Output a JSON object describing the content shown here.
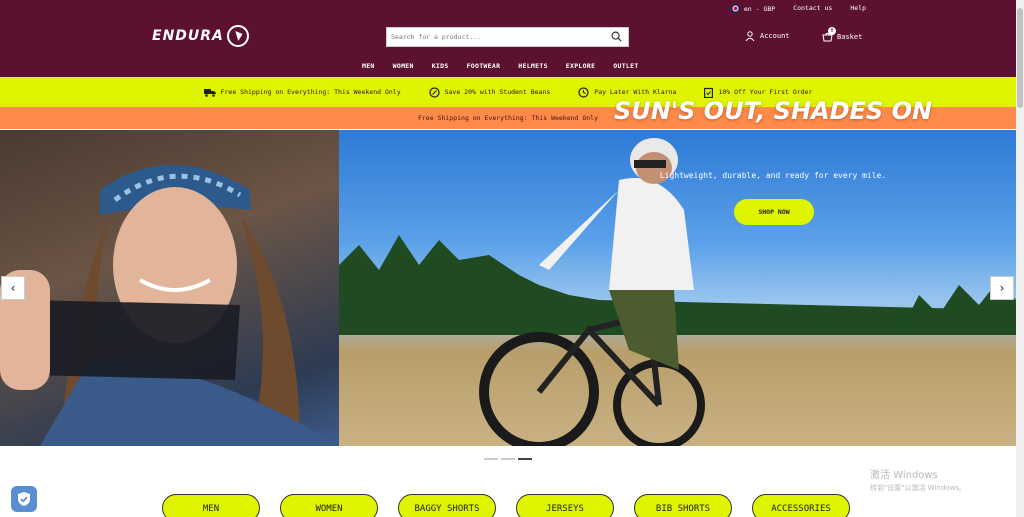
{
  "header": {
    "utility": {
      "locale": "en - GBP",
      "contact": "Contact us",
      "help": "Help"
    },
    "logo_text": "ENDURA",
    "search_placeholder": "Search for a product...",
    "account_label": "Account",
    "basket_label": "Basket",
    "basket_count": "0",
    "nav": [
      "MEN",
      "WOMEN",
      "KIDS",
      "FOOTWEAR",
      "HELMETS",
      "EXPLORE",
      "OUTLET"
    ]
  },
  "usp": [
    {
      "icon": "truck-icon",
      "text": "Free Shipping on Everything: This Weekend Only"
    },
    {
      "icon": "discount-icon",
      "text": "Save 20% with Student Beans"
    },
    {
      "icon": "clock-icon",
      "text": "Pay Later With Klarna"
    },
    {
      "icon": "clipboard-icon",
      "text": "10% Off Your First Order"
    }
  ],
  "promo_text": "Free Shipping on Everything: This Weekend Only",
  "hero": {
    "title": "SUN'S OUT, SHADES ON",
    "subtitle": "Lightweight, durable, and ready for every mile.",
    "cta": "SHOP NOW",
    "prev": "‹",
    "next": "›",
    "slide_count": 3,
    "active_slide": 3
  },
  "categories": [
    "MEN",
    "WOMEN",
    "BAGGY SHORTS",
    "JERSEYS",
    "BIB SHORTS",
    "ACCESSORIES"
  ],
  "watermark": {
    "line1": "激活 Windows",
    "line2": "转到\"设置\"以激活 Windows。"
  },
  "colors": {
    "header_bg": "#5c1131",
    "accent_lime": "#dff400",
    "promo_orange": "#ff8a4a"
  }
}
